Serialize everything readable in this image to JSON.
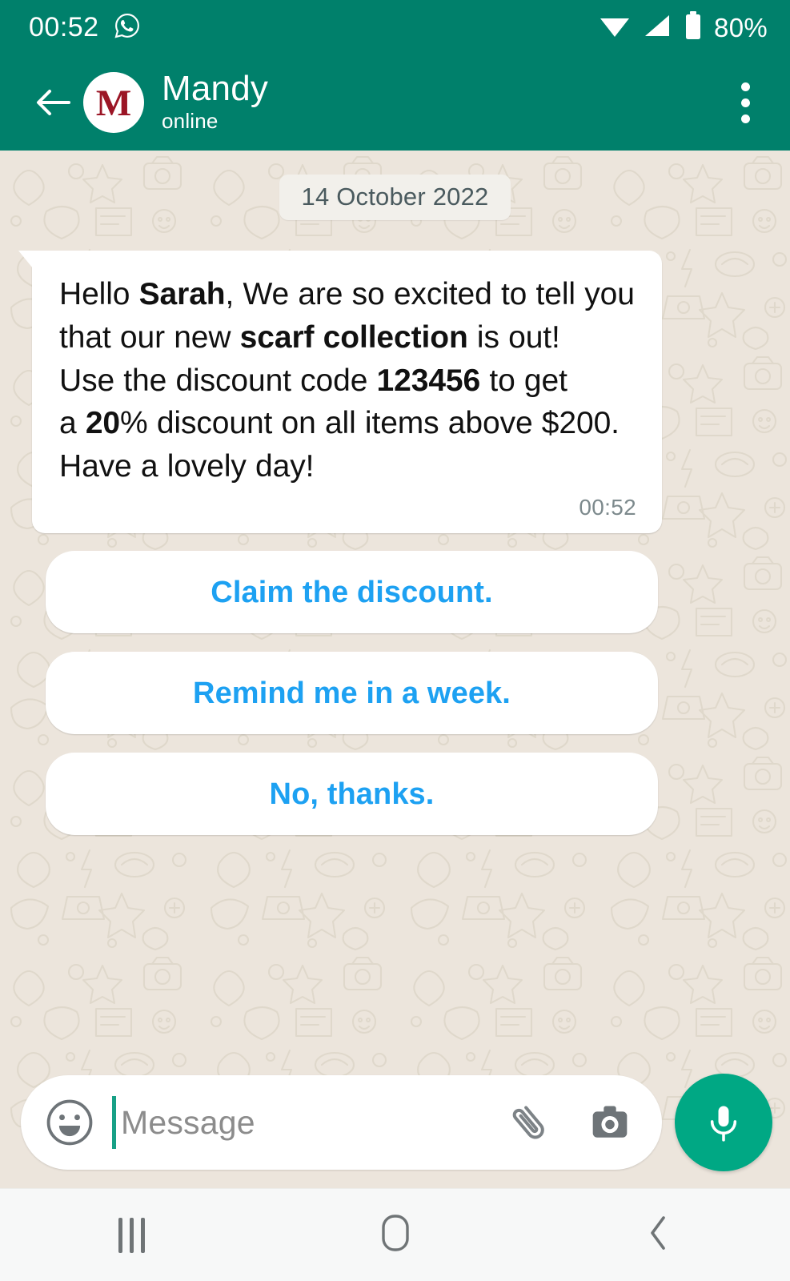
{
  "status_bar": {
    "clock": "00:52",
    "notification_icon": "whatsapp-icon",
    "wifi_icon": "wifi-icon",
    "signal_icon": "cellular-signal-icon",
    "battery_icon": "battery-icon",
    "battery_percent": "80%"
  },
  "header": {
    "back_icon": "back-arrow-icon",
    "avatar_letter": "M",
    "contact_name": "Mandy",
    "contact_status": "online",
    "overflow_icon": "overflow-menu-icon",
    "background_color": "#00806B"
  },
  "chat": {
    "date_divider": "14 October 2022",
    "message": {
      "time": "00:52",
      "lines": [
        [
          {
            "text": "Hello ",
            "bold": false
          },
          {
            "text": "Sarah",
            "bold": true
          },
          {
            "text": ", We are so excited to tell you",
            "bold": false
          }
        ],
        [
          {
            "text": "that our new ",
            "bold": false
          },
          {
            "text": "scarf collection",
            "bold": true
          },
          {
            "text": " is out!",
            "bold": false
          }
        ],
        [
          {
            "text": "Use the discount code ",
            "bold": false
          },
          {
            "text": "123456",
            "bold": true
          },
          {
            "text": " to get",
            "bold": false
          }
        ],
        [
          {
            "text": "a ",
            "bold": false
          },
          {
            "text": "20",
            "bold": true
          },
          {
            "text": "% discount on all items above $200.",
            "bold": false
          }
        ],
        [
          {
            "text": "Have a lovely day!",
            "bold": false
          }
        ]
      ]
    },
    "quick_replies": [
      {
        "label": "Claim the discount."
      },
      {
        "label": "Remind me in a week."
      },
      {
        "label": "No, thanks."
      }
    ],
    "quick_reply_color": "#1DA1F2",
    "background_color": "#ECE5DC"
  },
  "input_bar": {
    "emoji_icon": "emoji-smiley-icon",
    "placeholder": "Message",
    "attach_icon": "paperclip-icon",
    "camera_icon": "camera-icon",
    "mic_icon": "microphone-icon",
    "mic_button_color": "#00A884"
  },
  "nav_bar": {
    "recents_icon": "recents-icon",
    "home_icon": "home-icon",
    "back_icon": "nav-back-icon"
  }
}
